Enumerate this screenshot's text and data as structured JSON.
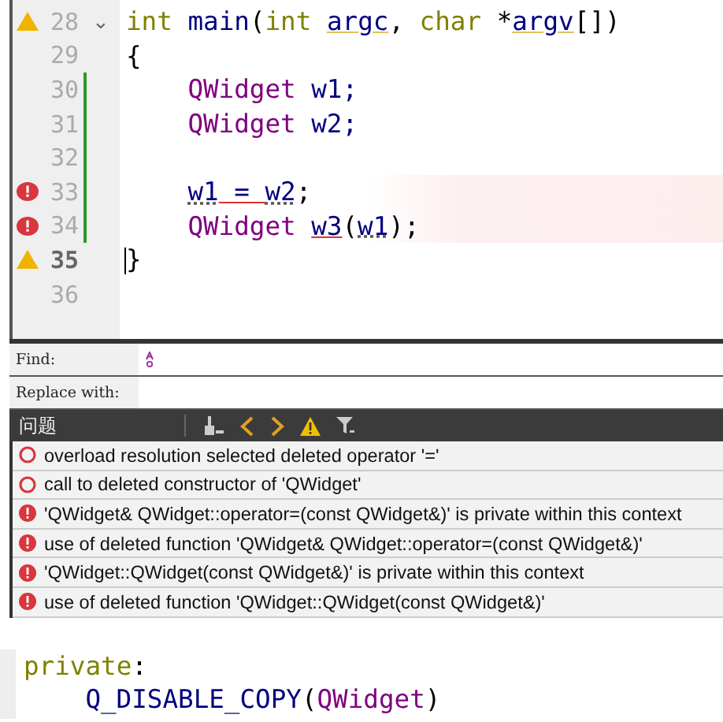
{
  "editor": {
    "lines": [
      {
        "number": "28",
        "kind": "warning",
        "fold": "⌄",
        "changed": false,
        "current": false,
        "highlight": false,
        "indented": false,
        "tokens": [
          {
            "text": "int ",
            "kind": "keyword"
          },
          {
            "text": "main",
            "kind": "ident"
          },
          {
            "text": "(",
            "kind": "plain"
          },
          {
            "text": "int ",
            "kind": "keyword"
          },
          {
            "text": "argc",
            "kind": "ident-warning"
          },
          {
            "text": ", ",
            "kind": "plain"
          },
          {
            "text": "char ",
            "kind": "keyword"
          },
          {
            "text": "*",
            "kind": "plain"
          },
          {
            "text": "argv",
            "kind": "ident-warning"
          },
          {
            "text": "[])",
            "kind": "plain"
          }
        ]
      },
      {
        "number": "29",
        "kind": "plain",
        "changed": false,
        "current": false,
        "highlight": false,
        "indented": false,
        "tokens": [
          {
            "text": "{",
            "kind": "plain"
          }
        ]
      },
      {
        "number": "30",
        "kind": "plain",
        "changed": true,
        "current": false,
        "highlight": false,
        "indented": true,
        "tokens": [
          {
            "text": "QWidget ",
            "kind": "type"
          },
          {
            "text": "w1;",
            "kind": "ident"
          }
        ]
      },
      {
        "number": "31",
        "kind": "plain",
        "changed": true,
        "current": false,
        "highlight": false,
        "indented": true,
        "tokens": [
          {
            "text": "QWidget ",
            "kind": "type"
          },
          {
            "text": "w2;",
            "kind": "ident"
          }
        ]
      },
      {
        "number": "32",
        "kind": "plain",
        "changed": true,
        "current": false,
        "highlight": false
      },
      {
        "number": "33",
        "kind": "error",
        "changed": true,
        "current": false,
        "highlight": true,
        "indented": true,
        "tokens": [
          {
            "text": "w1",
            "kind": "ident-dotted"
          },
          {
            "text": " = ",
            "kind": "ident-error"
          },
          {
            "text": "w2",
            "kind": "ident-dotted"
          },
          {
            "text": ";",
            "kind": "plain"
          }
        ]
      },
      {
        "number": "34",
        "kind": "error",
        "changed": true,
        "current": false,
        "highlight": true,
        "indented": true,
        "tokens": [
          {
            "text": "QWidget ",
            "kind": "type"
          },
          {
            "text": "w3",
            "kind": "ident-error"
          },
          {
            "text": "(",
            "kind": "plain"
          },
          {
            "text": "w1",
            "kind": "ident-dotted"
          },
          {
            "text": ");",
            "kind": "plain"
          }
        ]
      },
      {
        "number": "35",
        "kind": "warning",
        "changed": false,
        "current": true,
        "highlight": false,
        "indented": false,
        "tokens": [
          {
            "text": "}",
            "kind": "plain"
          }
        ]
      },
      {
        "number": "36",
        "kind": "plain",
        "changed": false,
        "current": false,
        "highlight": false
      }
    ]
  },
  "find_bar": {
    "find_label": "Find:",
    "replace_label": "Replace with:"
  },
  "problems": {
    "title": "问题",
    "items": [
      {
        "kind": "error-outline",
        "message": "overload resolution selected deleted operator '='"
      },
      {
        "kind": "error-outline",
        "message": "call to deleted constructor of 'QWidget'"
      },
      {
        "kind": "error",
        "message": "'QWidget& QWidget::operator=(const QWidget&)' is private within this context"
      },
      {
        "kind": "error",
        "message": "use of deleted function 'QWidget& QWidget::operator=(const QWidget&)'"
      },
      {
        "kind": "error",
        "message": "'QWidget::QWidget(const QWidget&)' is private within this context"
      },
      {
        "kind": "error",
        "message": "use of deleted function 'QWidget::QWidget(const QWidget&)'"
      }
    ]
  },
  "snippet": {
    "lines": [
      {
        "indented": false,
        "tokens": [
          {
            "text": "private",
            "kind": "keyword"
          },
          {
            "text": ":",
            "kind": "plain"
          }
        ]
      },
      {
        "indented": true,
        "tokens": [
          {
            "text": "Q_DISABLE_COPY",
            "kind": "ident"
          },
          {
            "text": "(",
            "kind": "plain"
          },
          {
            "text": "QWidget",
            "kind": "type"
          },
          {
            "text": ")",
            "kind": "plain"
          }
        ]
      }
    ]
  }
}
